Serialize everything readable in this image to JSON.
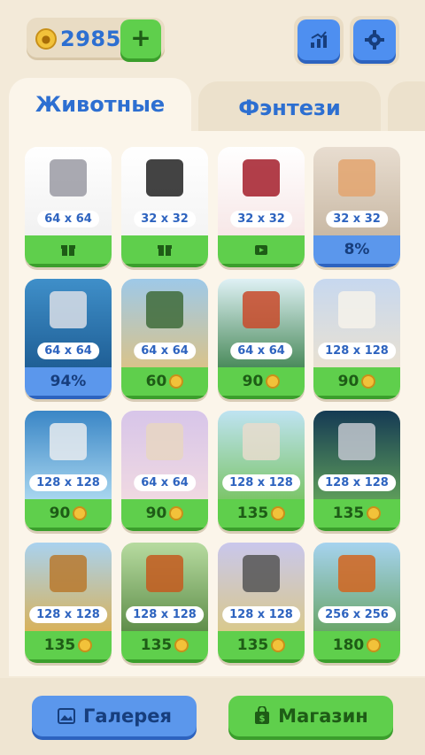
{
  "header": {
    "coins": "2985",
    "add_label": "+"
  },
  "tabs": [
    {
      "label": "Животные"
    },
    {
      "label": "Фэнтези"
    }
  ],
  "cards": [
    {
      "size": "64 x 64",
      "footer": "",
      "footer_type": "gift",
      "theme": "bat"
    },
    {
      "size": "32 x 32",
      "footer": "",
      "footer_type": "gift",
      "theme": "penguin"
    },
    {
      "size": "32 x 32",
      "footer": "",
      "footer_type": "video",
      "theme": "ladybug"
    },
    {
      "size": "32 x 32",
      "footer": "8%",
      "footer_type": "progress",
      "theme": "cat"
    },
    {
      "size": "64 x 64",
      "footer": "94%",
      "footer_type": "progress",
      "theme": "kitten"
    },
    {
      "size": "64 x 64",
      "footer": "60",
      "footer_type": "price",
      "theme": "duck"
    },
    {
      "size": "64 x 64",
      "footer": "90",
      "footer_type": "price",
      "theme": "robin"
    },
    {
      "size": "128 x 128",
      "footer": "90",
      "footer_type": "price",
      "theme": "chickens"
    },
    {
      "size": "128 x 128",
      "footer": "90",
      "footer_type": "price",
      "theme": "owl"
    },
    {
      "size": "64 x 64",
      "footer": "90",
      "footer_type": "price",
      "theme": "tiger"
    },
    {
      "size": "128 x 128",
      "footer": "135",
      "footer_type": "price",
      "theme": "cow"
    },
    {
      "size": "128 x 128",
      "footer": "135",
      "footer_type": "price",
      "theme": "horse"
    },
    {
      "size": "128 x 128",
      "footer": "135",
      "footer_type": "price",
      "theme": "lion"
    },
    {
      "size": "128 x 128",
      "footer": "135",
      "footer_type": "price",
      "theme": "squirrel"
    },
    {
      "size": "128 x 128",
      "footer": "135",
      "footer_type": "price",
      "theme": "zebra"
    },
    {
      "size": "256 x 256",
      "footer": "180",
      "footer_type": "price",
      "theme": "fox"
    }
  ],
  "bottom": {
    "gallery_label": "Галерея",
    "shop_label": "Магазин"
  }
}
